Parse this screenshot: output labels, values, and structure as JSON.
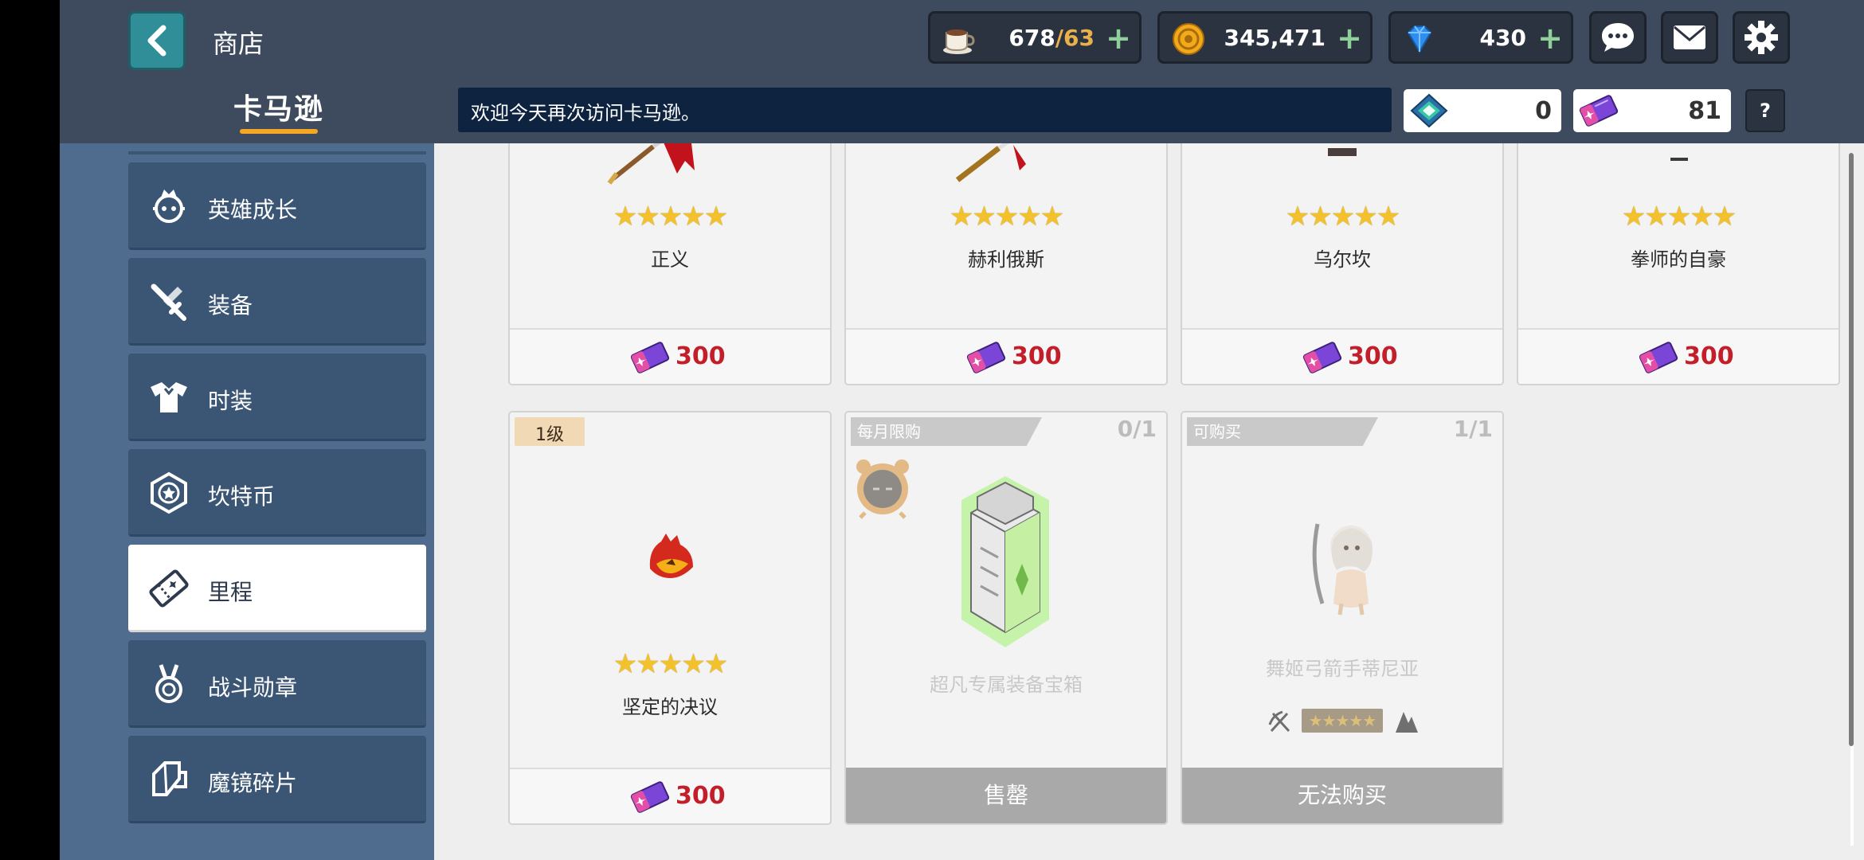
{
  "header": {
    "title": "商店",
    "shop_name": "卡马逊",
    "welcome_message": "欢迎今天再次访问卡马逊。",
    "stamina": {
      "current": "678",
      "separator": "/",
      "max": "63",
      "plus": "+"
    },
    "gold": {
      "value": "345,471",
      "plus": "+"
    },
    "gems": {
      "value": "430",
      "plus": "+"
    },
    "mileage_token": {
      "value": "0"
    },
    "mileage_ticket": {
      "value": "81"
    },
    "help_label": "?"
  },
  "sidebar": {
    "items": [
      {
        "label": "英雄成长",
        "icon": "hero-growth-icon"
      },
      {
        "label": "装备",
        "icon": "equipment-icon"
      },
      {
        "label": "时装",
        "icon": "costume-icon"
      },
      {
        "label": "坎特币",
        "icon": "kanterbury-coin-icon"
      },
      {
        "label": "里程",
        "icon": "mileage-ticket-icon",
        "active": true
      },
      {
        "label": "战斗勋章",
        "icon": "battle-medal-icon"
      },
      {
        "label": "魔镜碎片",
        "icon": "mirror-shard-icon"
      }
    ]
  },
  "products": {
    "row1": [
      {
        "name": "正义",
        "stars": "★★★★★",
        "price": "300"
      },
      {
        "name": "赫利俄斯",
        "stars": "★★★★★",
        "price": "300"
      },
      {
        "name": "乌尔坎",
        "stars": "★★★★★",
        "price": "300"
      },
      {
        "name": "拳师的自豪",
        "stars": "★★★★★",
        "price": "300"
      }
    ],
    "row2": [
      {
        "tag": "1级",
        "name": "坚定的决议",
        "stars": "★★★★★",
        "price": "300"
      },
      {
        "tag": "每月限购",
        "count": "0/1",
        "name": "超凡专属装备宝箱",
        "button": "售罄"
      },
      {
        "tag": "可购买",
        "count": "1/1",
        "name": "舞姬弓箭手蒂尼亚",
        "button": "无法购买"
      }
    ]
  },
  "colors": {
    "header_bg": "#3e4b5e",
    "sidebar_bg": "#4f6b8d",
    "sidebar_item_bg": "#3b5575",
    "price_red": "#c31f2a",
    "star_gold": "#f3c12c",
    "back_teal": "#2f8e98"
  }
}
